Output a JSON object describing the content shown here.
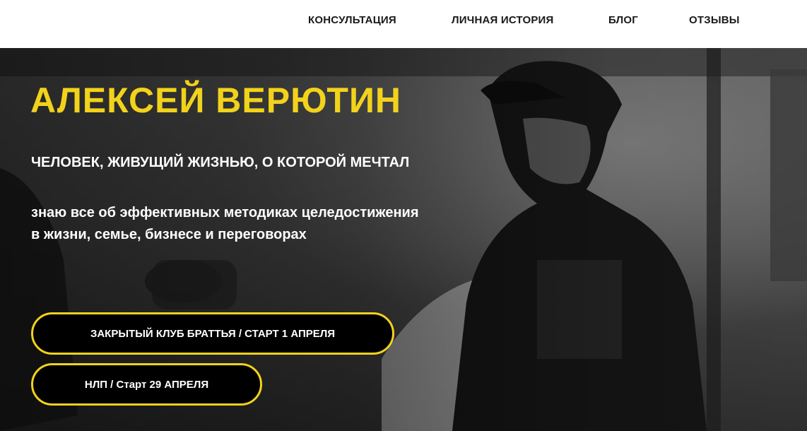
{
  "nav": {
    "items": [
      {
        "label": "КОНСУЛЬТАЦИЯ"
      },
      {
        "label": "ЛИЧНАЯ ИСТОРИЯ"
      },
      {
        "label": "БЛОГ"
      },
      {
        "label": "ОТЗЫВЫ"
      }
    ]
  },
  "hero": {
    "title": "АЛЕКСЕЙ ВЕРЮТИН",
    "subtitle": "ЧЕЛОВЕК, ЖИВУЩИЙ ЖИЗНЬЮ, О КОТОРОЙ МЕЧТАЛ",
    "description_line1": "знаю все об эффективных методиках целедостижения",
    "description_line2": "в жизни, семье, бизнесе и переговорах",
    "buttons": [
      {
        "label": "ЗАКРЫТЫЙ КЛУБ БРАТТЬЯ / СТАРТ 1 АПРЕЛЯ"
      },
      {
        "label": "НЛП / Старт 29 АПРЕЛЯ"
      }
    ]
  },
  "colors": {
    "accent": "#f2d21b",
    "button_bg": "#000000",
    "nav_text": "#1a1a1a",
    "hero_text": "#ffffff"
  }
}
